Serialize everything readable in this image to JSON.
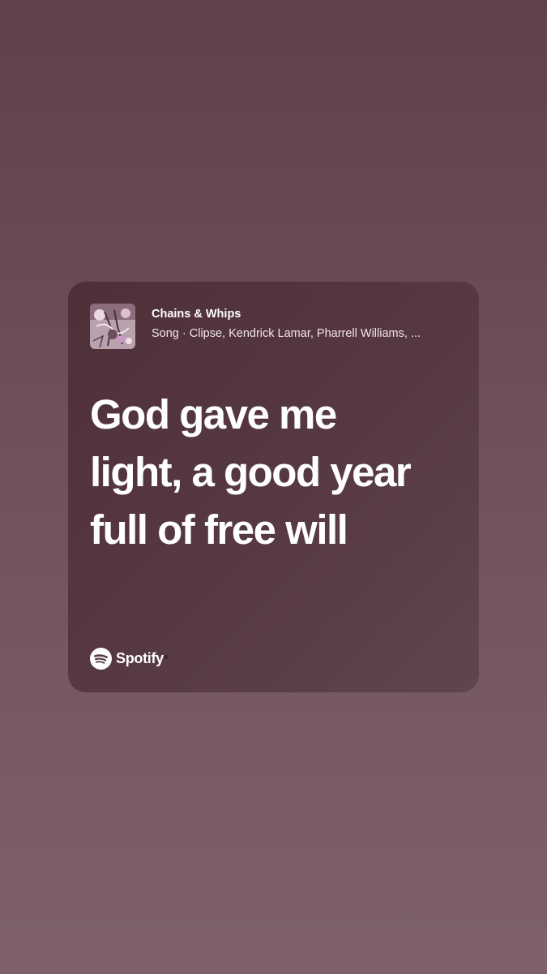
{
  "share_card": {
    "song_title": "Chains & Whips",
    "song_subtitle": "Song · Clipse, Kendrick Lamar, Pharrell Williams, ...",
    "lyrics": [
      "God gave me",
      "light, a good year",
      "full of free will"
    ],
    "brand": {
      "name": "Spotify",
      "icon": "spotify-icon"
    },
    "album_art_icon": "album-art"
  },
  "colors": {
    "background_top": "#5f414b",
    "background_bottom": "#7e616a",
    "card": "#573943",
    "text": "#ffffff"
  }
}
